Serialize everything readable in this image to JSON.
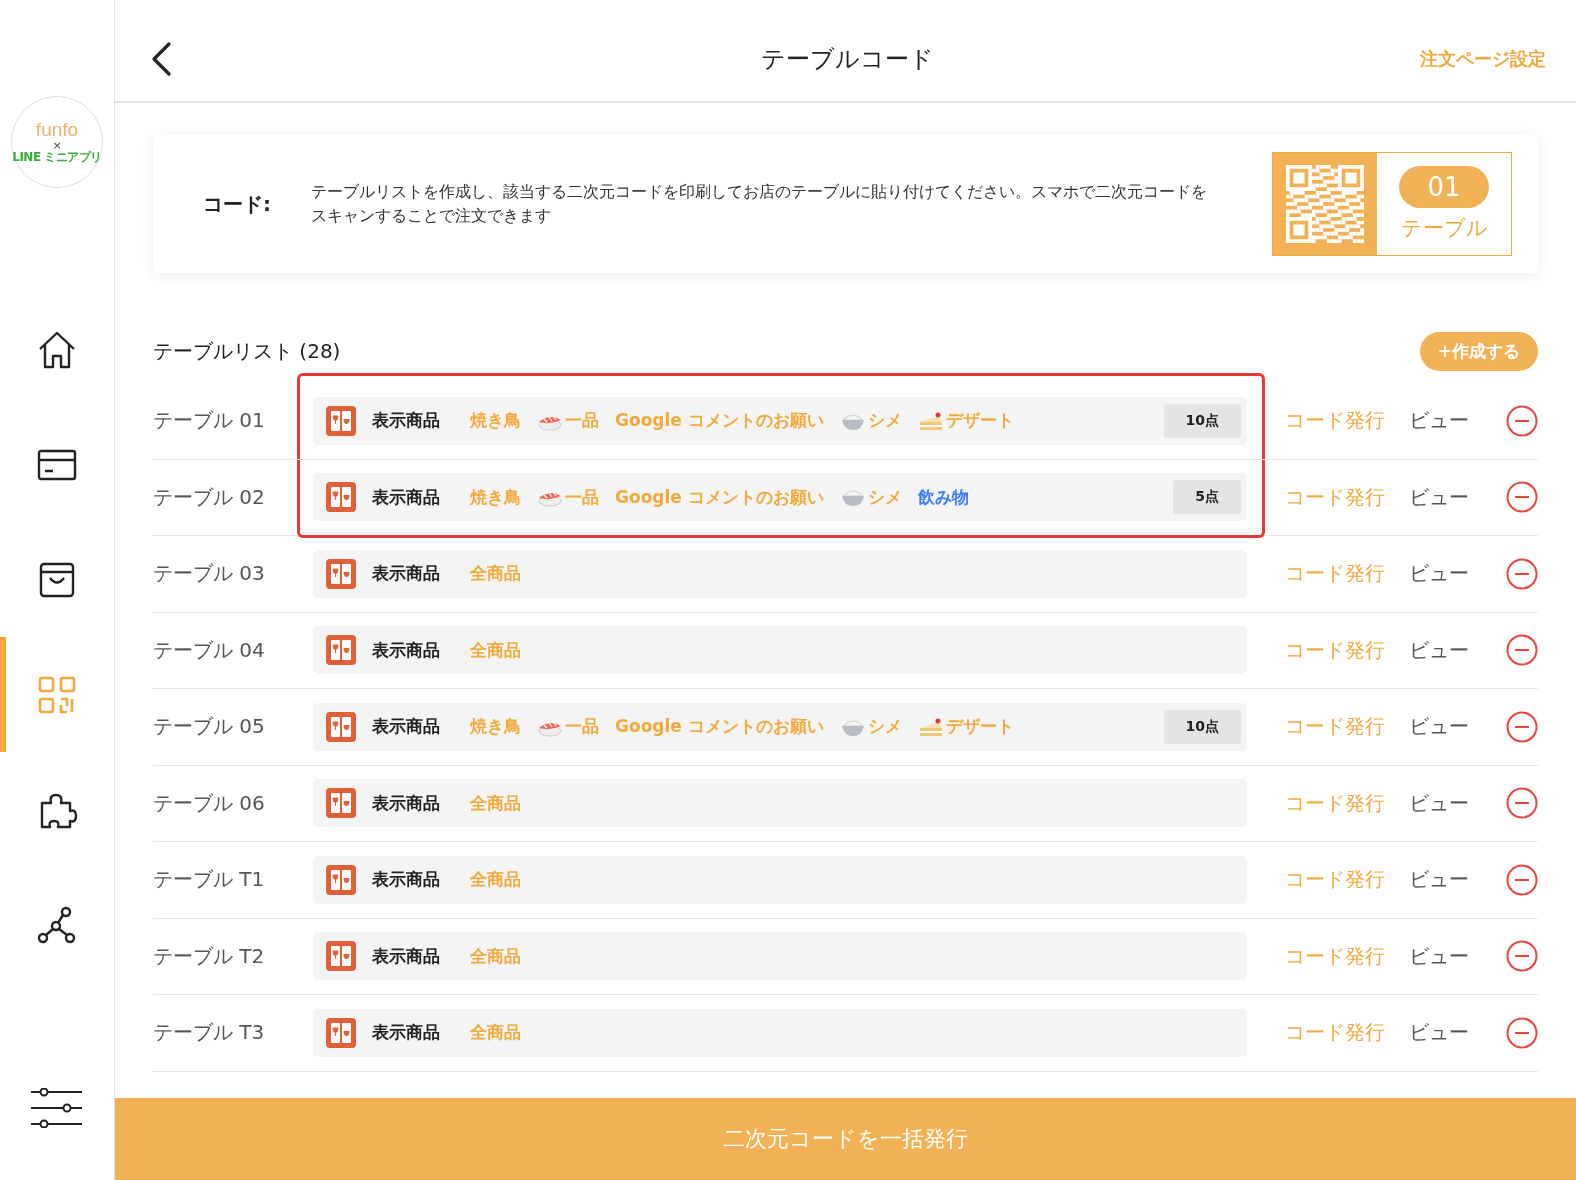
{
  "sidebar": {
    "logo": {
      "brand": "funfo",
      "cross": "×",
      "partner": "LINE ミニアプリ"
    },
    "items": [
      {
        "kind": "home",
        "selected": false
      },
      {
        "kind": "card",
        "selected": false
      },
      {
        "kind": "bag",
        "selected": false
      },
      {
        "kind": "qr",
        "selected": true
      },
      {
        "kind": "puzzle",
        "selected": false
      },
      {
        "kind": "network",
        "selected": false
      }
    ],
    "settings": {
      "kind": "sliders"
    }
  },
  "header": {
    "title": "テーブルコード",
    "action": "注文ページ設定"
  },
  "code_card": {
    "label": "コード:",
    "description": "テーブルリストを作成し、該当する二次元コードを印刷してお店のテーブルに貼り付けてください。スマホで二次元コードをスキャンすることで注文できます",
    "sample_number": "01",
    "sample_caption": "テーブル"
  },
  "table_list": {
    "title": "テーブルリスト (28)",
    "create_button": "+作成する",
    "rows": [
      {
        "name": "テーブル 01",
        "highlighted": true,
        "label": "表示商品",
        "tags": [
          {
            "text": "焼き鳥",
            "kind": "plain",
            "color": "#f2a93b"
          },
          {
            "text": "一品",
            "kind": "sushi",
            "color": "#f2a93b"
          },
          {
            "text": "Google コメントのお願い",
            "kind": "plain",
            "color": "#f2a93b"
          },
          {
            "text": "シメ",
            "kind": "rice",
            "color": "#f2a93b"
          },
          {
            "text": "デザート",
            "kind": "cake",
            "color": "#f2a93b"
          }
        ],
        "count": "10点",
        "issue": "コード発行",
        "view": "ビュー"
      },
      {
        "name": "テーブル 02",
        "highlighted": true,
        "label": "表示商品",
        "tags": [
          {
            "text": "焼き鳥",
            "kind": "plain",
            "color": "#f2a93b"
          },
          {
            "text": "一品",
            "kind": "sushi",
            "color": "#f2a93b"
          },
          {
            "text": "Google コメントのお願い",
            "kind": "plain",
            "color": "#f2a93b"
          },
          {
            "text": "シメ",
            "kind": "rice",
            "color": "#f2a93b"
          },
          {
            "text": "飲み物",
            "kind": "plain",
            "color": "#3d7ef0"
          }
        ],
        "count": "5点",
        "issue": "コード発行",
        "view": "ビュー"
      },
      {
        "name": "テーブル 03",
        "highlighted": false,
        "label": "表示商品",
        "tags": [
          {
            "text": "全商品",
            "kind": "plain",
            "color": "#f2a93b"
          }
        ],
        "issue": "コード発行",
        "view": "ビュー"
      },
      {
        "name": "テーブル 04",
        "highlighted": false,
        "label": "表示商品",
        "tags": [
          {
            "text": "全商品",
            "kind": "plain",
            "color": "#f2a93b"
          }
        ],
        "issue": "コード発行",
        "view": "ビュー"
      },
      {
        "name": "テーブル 05",
        "highlighted": false,
        "label": "表示商品",
        "tags": [
          {
            "text": "焼き鳥",
            "kind": "plain",
            "color": "#f2a93b"
          },
          {
            "text": "一品",
            "kind": "sushi",
            "color": "#f2a93b"
          },
          {
            "text": "Google コメントのお願い",
            "kind": "plain",
            "color": "#f2a93b"
          },
          {
            "text": "シメ",
            "kind": "rice",
            "color": "#f2a93b"
          },
          {
            "text": "デザート",
            "kind": "cake",
            "color": "#f2a93b"
          }
        ],
        "count": "10点",
        "issue": "コード発行",
        "view": "ビュー"
      },
      {
        "name": "テーブル 06",
        "highlighted": false,
        "label": "表示商品",
        "tags": [
          {
            "text": "全商品",
            "kind": "plain",
            "color": "#f2a93b"
          }
        ],
        "issue": "コード発行",
        "view": "ビュー"
      },
      {
        "name": "テーブル T1",
        "highlighted": false,
        "label": "表示商品",
        "tags": [
          {
            "text": "全商品",
            "kind": "plain",
            "color": "#f2a93b"
          }
        ],
        "issue": "コード発行",
        "view": "ビュー"
      },
      {
        "name": "テーブル T2",
        "highlighted": false,
        "label": "表示商品",
        "tags": [
          {
            "text": "全商品",
            "kind": "plain",
            "color": "#f2a93b"
          }
        ],
        "issue": "コード発行",
        "view": "ビュー"
      },
      {
        "name": "テーブル T3",
        "highlighted": false,
        "label": "表示商品",
        "tags": [
          {
            "text": "全商品",
            "kind": "plain",
            "color": "#f2a93b"
          }
        ],
        "issue": "コード発行",
        "view": "ビュー"
      }
    ]
  },
  "bottom_button": "二次元コードを一括発行"
}
